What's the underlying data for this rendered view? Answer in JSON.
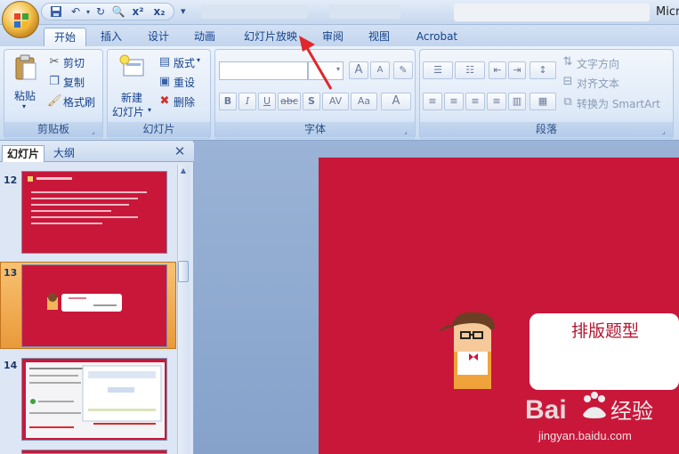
{
  "app": {
    "title": "Micro"
  },
  "qat": {
    "save": "save-icon",
    "undo": "undo-icon",
    "redo": "redo-icon",
    "print_preview": "print-preview-icon",
    "superscript": "x²",
    "subscript": "x₂",
    "customize": "▾"
  },
  "tabs": [
    {
      "label": "开始",
      "active": true
    },
    {
      "label": "插入"
    },
    {
      "label": "设计"
    },
    {
      "label": "动画"
    },
    {
      "label": "幻灯片放映"
    },
    {
      "label": "审阅"
    },
    {
      "label": "视图"
    },
    {
      "label": "Acrobat"
    }
  ],
  "ribbon": {
    "clipboard": {
      "label": "剪贴板",
      "paste": "粘贴",
      "cut": "剪切",
      "copy": "复制",
      "format_painter": "格式刷"
    },
    "slides": {
      "label": "幻灯片",
      "new_slide_line1": "新建",
      "new_slide_line2": "幻灯片",
      "layout": "版式",
      "reset": "重设",
      "delete": "删除"
    },
    "font": {
      "label": "字体",
      "bold": "B",
      "italic": "I",
      "underline": "U",
      "strike": "abc",
      "shadow": "S",
      "spacing": "AV",
      "case": "Aa",
      "color": "A",
      "grow": "A",
      "shrink": "A"
    },
    "paragraph": {
      "label": "段落",
      "text_direction": "文字方向",
      "align_text": "对齐文本",
      "convert_smartart": "转换为 SmartArt"
    }
  },
  "panel": {
    "tabs": [
      "幻灯片",
      "大纲"
    ],
    "close": "✕"
  },
  "thumbnails": [
    {
      "number": "12"
    },
    {
      "number": "13",
      "selected": true
    },
    {
      "number": "14"
    }
  ],
  "slide": {
    "title": "排版题型"
  },
  "watermark": {
    "text": "jingyan.baidu.com"
  },
  "colors": {
    "slide_bg": "#c9173a",
    "ribbon_bg": "#dbe7f6",
    "tab_text": "#15428b",
    "arrow": "#e0272b"
  }
}
